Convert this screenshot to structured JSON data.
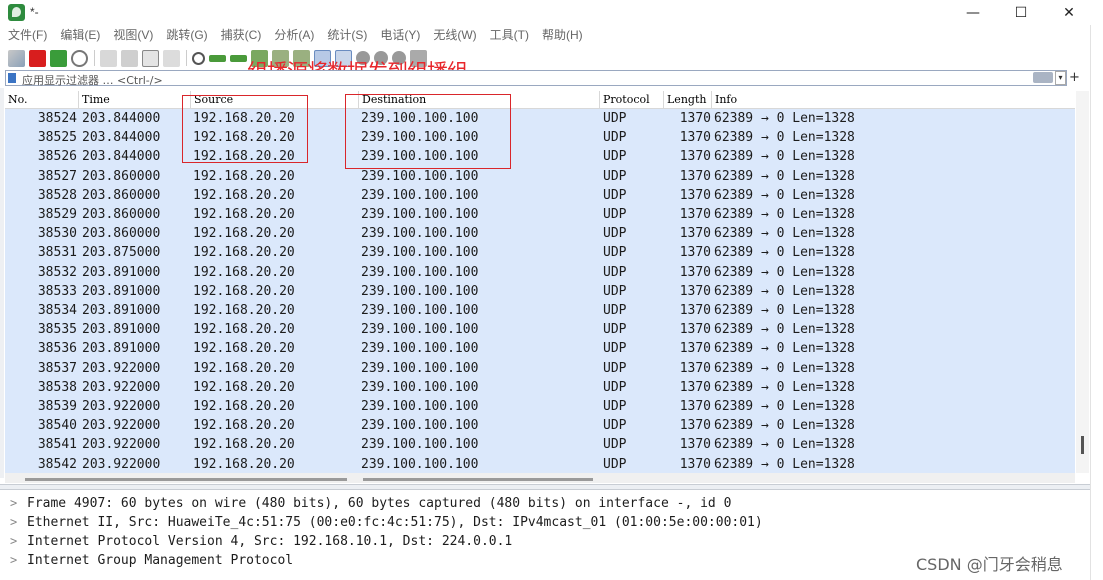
{
  "window": {
    "title": "*-",
    "minimize_glyph": "—",
    "maximize_glyph": "☐",
    "close_glyph": "✕"
  },
  "menu": [
    "文件(F)",
    "编辑(E)",
    "视图(V)",
    "跳转(G)",
    "捕获(C)",
    "分析(A)",
    "统计(S)",
    "电话(Y)",
    "无线(W)",
    "工具(T)",
    "帮助(H)"
  ],
  "toolbar": {
    "icons": [
      "shark-fin-start-icon",
      "stop-capture-icon",
      "restart-capture-icon",
      "capture-options-icon",
      "open-file-icon",
      "save-file-icon",
      "close-file-icon",
      "reload-file-icon",
      "find-packet-icon",
      "go-back-icon",
      "go-forward-icon",
      "go-to-packet-icon",
      "go-first-icon",
      "go-last-icon",
      "auto-scroll-icon",
      "colorize-icon",
      "zoom-in-icon",
      "zoom-out-icon",
      "zoom-normal-icon",
      "resize-columns-icon"
    ]
  },
  "annotation": {
    "text": "组播源将数据发到组播组",
    "color": "#e8262b"
  },
  "filter": {
    "placeholder": "应用显示过滤器 … <Ctrl-/>",
    "add_button": "+"
  },
  "packet_list": {
    "columns": [
      "No.",
      "Time",
      "Source",
      "Destination",
      "Protocol",
      "Length",
      "Info"
    ],
    "rows": [
      [
        "38524",
        "203.844000",
        "192.168.20.20",
        "239.100.100.100",
        "UDP",
        "1370",
        "62389 → 0 Len=1328"
      ],
      [
        "38525",
        "203.844000",
        "192.168.20.20",
        "239.100.100.100",
        "UDP",
        "1370",
        "62389 → 0 Len=1328"
      ],
      [
        "38526",
        "203.844000",
        "192.168.20.20",
        "239.100.100.100",
        "UDP",
        "1370",
        "62389 → 0 Len=1328"
      ],
      [
        "38527",
        "203.860000",
        "192.168.20.20",
        "239.100.100.100",
        "UDP",
        "1370",
        "62389 → 0 Len=1328"
      ],
      [
        "38528",
        "203.860000",
        "192.168.20.20",
        "239.100.100.100",
        "UDP",
        "1370",
        "62389 → 0 Len=1328"
      ],
      [
        "38529",
        "203.860000",
        "192.168.20.20",
        "239.100.100.100",
        "UDP",
        "1370",
        "62389 → 0 Len=1328"
      ],
      [
        "38530",
        "203.860000",
        "192.168.20.20",
        "239.100.100.100",
        "UDP",
        "1370",
        "62389 → 0 Len=1328"
      ],
      [
        "38531",
        "203.875000",
        "192.168.20.20",
        "239.100.100.100",
        "UDP",
        "1370",
        "62389 → 0 Len=1328"
      ],
      [
        "38532",
        "203.891000",
        "192.168.20.20",
        "239.100.100.100",
        "UDP",
        "1370",
        "62389 → 0 Len=1328"
      ],
      [
        "38533",
        "203.891000",
        "192.168.20.20",
        "239.100.100.100",
        "UDP",
        "1370",
        "62389 → 0 Len=1328"
      ],
      [
        "38534",
        "203.891000",
        "192.168.20.20",
        "239.100.100.100",
        "UDP",
        "1370",
        "62389 → 0 Len=1328"
      ],
      [
        "38535",
        "203.891000",
        "192.168.20.20",
        "239.100.100.100",
        "UDP",
        "1370",
        "62389 → 0 Len=1328"
      ],
      [
        "38536",
        "203.891000",
        "192.168.20.20",
        "239.100.100.100",
        "UDP",
        "1370",
        "62389 → 0 Len=1328"
      ],
      [
        "38537",
        "203.922000",
        "192.168.20.20",
        "239.100.100.100",
        "UDP",
        "1370",
        "62389 → 0 Len=1328"
      ],
      [
        "38538",
        "203.922000",
        "192.168.20.20",
        "239.100.100.100",
        "UDP",
        "1370",
        "62389 → 0 Len=1328"
      ],
      [
        "38539",
        "203.922000",
        "192.168.20.20",
        "239.100.100.100",
        "UDP",
        "1370",
        "62389 → 0 Len=1328"
      ],
      [
        "38540",
        "203.922000",
        "192.168.20.20",
        "239.100.100.100",
        "UDP",
        "1370",
        "62389 → 0 Len=1328"
      ],
      [
        "38541",
        "203.922000",
        "192.168.20.20",
        "239.100.100.100",
        "UDP",
        "1370",
        "62389 → 0 Len=1328"
      ],
      [
        "38542",
        "203.922000",
        "192.168.20.20",
        "239.100.100.100",
        "UDP",
        "1370",
        "62389 → 0 Len=1328"
      ]
    ]
  },
  "details": [
    "Frame 4907: 60 bytes on wire (480 bits), 60 bytes captured (480 bits) on interface -, id 0",
    "Ethernet II, Src: HuaweiTe_4c:51:75 (00:e0:fc:4c:51:75), Dst: IPv4mcast_01 (01:00:5e:00:00:01)",
    "Internet Protocol Version 4, Src: 192.168.10.1, Dst: 224.0.0.1",
    "Internet Group Management Protocol"
  ],
  "detail_chevron": ">",
  "watermark": "CSDN @门牙会稍息",
  "colors": {
    "row_bg": "#dbe8fb",
    "annotation_red": "#e8262b"
  }
}
